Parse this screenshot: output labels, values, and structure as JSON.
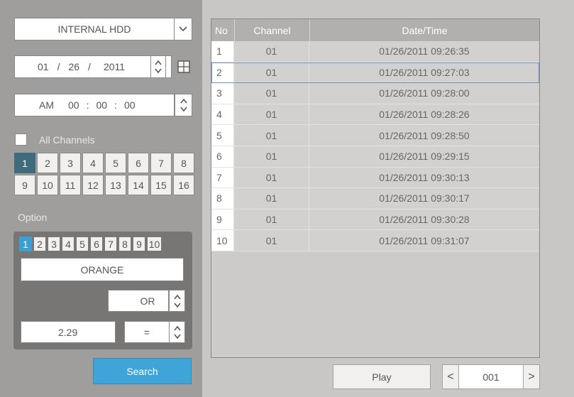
{
  "storage": {
    "selected": "INTERNAL HDD",
    "dropdown_icon": "chevron-down-icon"
  },
  "date": {
    "month": "01",
    "sep1": "/",
    "day": "26",
    "sep2": "/",
    "year": "2011",
    "calendar_icon": "calendar-grid-icon"
  },
  "time": {
    "meridiem": "AM",
    "hour": "00",
    "sep1": ":",
    "minute": "00",
    "sep2": ":",
    "second": "00"
  },
  "channels": {
    "all_label": "All Channels",
    "all_checked": false,
    "buttons": [
      "1",
      "2",
      "3",
      "4",
      "5",
      "6",
      "7",
      "8",
      "9",
      "10",
      "11",
      "12",
      "13",
      "14",
      "15",
      "16"
    ],
    "active": "1"
  },
  "option": {
    "label": "Option",
    "tabs": [
      "1",
      "2",
      "3",
      "4",
      "5",
      "6",
      "7",
      "8",
      "9",
      "10"
    ],
    "active_tab": "1",
    "text_value": "ORANGE",
    "logic": "OR",
    "number_value": "2.29",
    "operator": "="
  },
  "search_label": "Search",
  "table": {
    "headers": {
      "no": "No",
      "channel": "Channel",
      "datetime": "Date/Time"
    },
    "selected_row": 2,
    "rows": [
      {
        "no": "1",
        "channel": "01",
        "datetime": "01/26/2011  09:26:35"
      },
      {
        "no": "2",
        "channel": "01",
        "datetime": "01/26/2011  09:27:03"
      },
      {
        "no": "3",
        "channel": "01",
        "datetime": "01/26/2011  09:28:00"
      },
      {
        "no": "4",
        "channel": "01",
        "datetime": "01/26/2011  09:28:26"
      },
      {
        "no": "5",
        "channel": "01",
        "datetime": "01/26/2011  09:28:50"
      },
      {
        "no": "6",
        "channel": "01",
        "datetime": "01/26/2011  09:29:15"
      },
      {
        "no": "7",
        "channel": "01",
        "datetime": "01/26/2011  09:30:13"
      },
      {
        "no": "8",
        "channel": "01",
        "datetime": "01/26/2011  09:30:17"
      },
      {
        "no": "9",
        "channel": "01",
        "datetime": "01/26/2011  09:30:28"
      },
      {
        "no": "10",
        "channel": "01",
        "datetime": "01/26/2011  09:31:07"
      }
    ]
  },
  "play_label": "Play",
  "pager": {
    "prev": "<",
    "page": "001",
    "next": ">"
  },
  "colors": {
    "accent": "#3fa5d8",
    "active_channel": "#3f6c7c",
    "panel": "#a09e9c"
  }
}
